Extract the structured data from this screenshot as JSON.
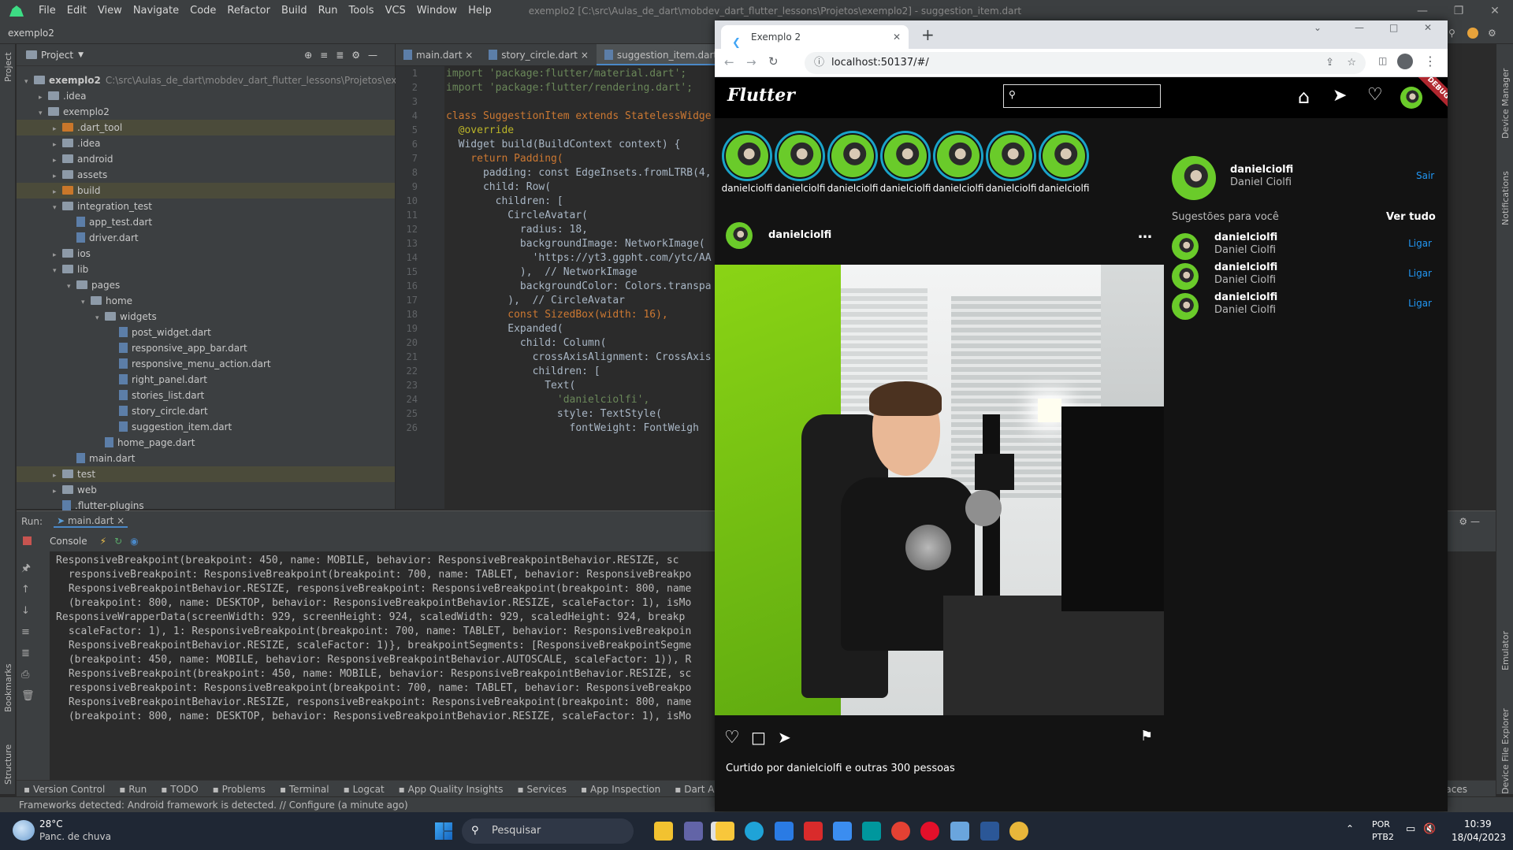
{
  "ide": {
    "menu": [
      "File",
      "Edit",
      "View",
      "Navigate",
      "Code",
      "Refactor",
      "Build",
      "Run",
      "Tools",
      "VCS",
      "Window",
      "Help"
    ],
    "title": "exemplo2 [C:\\src\\Aulas_de_dart\\mobdev_dart_flutter_lessons\\Projetos\\exemplo2] - suggestion_item.dart",
    "breadcrumb": "exemplo2",
    "project_label": "Project",
    "left_strip": [
      "Project",
      "Bookmarks",
      "Structure"
    ],
    "right_strip": [
      "Device Manager",
      "Notifications",
      "Emulator",
      "Device File Explorer"
    ],
    "tree": [
      {
        "label": "exemplo2",
        "extra": "C:\\src\\Aulas_de_dart\\mobdev_dart_flutter_lessons\\Projetos\\exemplc",
        "indent": 0,
        "arrow": "▾",
        "kind": "folder"
      },
      {
        "label": ".idea",
        "indent": 1,
        "arrow": "▸",
        "kind": "folder"
      },
      {
        "label": "exemplo2",
        "indent": 1,
        "arrow": "▾",
        "kind": "folder"
      },
      {
        "label": ".dart_tool",
        "indent": 2,
        "arrow": "▸",
        "kind": "folder-orange",
        "sel": true
      },
      {
        "label": ".idea",
        "indent": 2,
        "arrow": "▸",
        "kind": "folder"
      },
      {
        "label": "android",
        "indent": 2,
        "arrow": "▸",
        "kind": "folder"
      },
      {
        "label": "assets",
        "indent": 2,
        "arrow": "▸",
        "kind": "folder"
      },
      {
        "label": "build",
        "indent": 2,
        "arrow": "▸",
        "kind": "folder-orange",
        "sel": true
      },
      {
        "label": "integration_test",
        "indent": 2,
        "arrow": "▾",
        "kind": "folder"
      },
      {
        "label": "app_test.dart",
        "indent": 3,
        "arrow": "",
        "kind": "dart"
      },
      {
        "label": "driver.dart",
        "indent": 3,
        "arrow": "",
        "kind": "dart"
      },
      {
        "label": "ios",
        "indent": 2,
        "arrow": "▸",
        "kind": "folder"
      },
      {
        "label": "lib",
        "indent": 2,
        "arrow": "▾",
        "kind": "folder"
      },
      {
        "label": "pages",
        "indent": 3,
        "arrow": "▾",
        "kind": "folder"
      },
      {
        "label": "home",
        "indent": 4,
        "arrow": "▾",
        "kind": "folder"
      },
      {
        "label": "widgets",
        "indent": 5,
        "arrow": "▾",
        "kind": "folder"
      },
      {
        "label": "post_widget.dart",
        "indent": 6,
        "arrow": "",
        "kind": "dart"
      },
      {
        "label": "responsive_app_bar.dart",
        "indent": 6,
        "arrow": "",
        "kind": "dart"
      },
      {
        "label": "responsive_menu_action.dart",
        "indent": 6,
        "arrow": "",
        "kind": "dart"
      },
      {
        "label": "right_panel.dart",
        "indent": 6,
        "arrow": "",
        "kind": "dart"
      },
      {
        "label": "stories_list.dart",
        "indent": 6,
        "arrow": "",
        "kind": "dart"
      },
      {
        "label": "story_circle.dart",
        "indent": 6,
        "arrow": "",
        "kind": "dart"
      },
      {
        "label": "suggestion_item.dart",
        "indent": 6,
        "arrow": "",
        "kind": "dart"
      },
      {
        "label": "home_page.dart",
        "indent": 5,
        "arrow": "",
        "kind": "dart"
      },
      {
        "label": "main.dart",
        "indent": 3,
        "arrow": "",
        "kind": "dart"
      },
      {
        "label": "test",
        "indent": 2,
        "arrow": "▸",
        "kind": "folder",
        "sel": true
      },
      {
        "label": "web",
        "indent": 2,
        "arrow": "▸",
        "kind": "folder"
      },
      {
        "label": ".flutter-plugins",
        "indent": 2,
        "arrow": "",
        "kind": "dart"
      }
    ],
    "editor_tabs": [
      "main.dart",
      "story_circle.dart",
      "suggestion_item.dart"
    ],
    "line_numbers": [
      "1",
      "2",
      "3",
      "4",
      "5",
      "6",
      "7",
      "8",
      "9",
      "10",
      "11",
      "12",
      "13",
      "14",
      "15",
      "16",
      "17",
      "18",
      "19",
      "20",
      "21",
      "22",
      "23",
      "24",
      "25",
      "26"
    ],
    "code_lines": [
      "import 'package:flutter/material.dart';",
      "import 'package:flutter/rendering.dart';",
      "",
      "class SuggestionItem extends StatelessWidge",
      "  @override",
      "  Widget build(BuildContext context) {",
      "    return Padding(",
      "      padding: const EdgeInsets.fromLTRB(4,",
      "      child: Row(",
      "        children: [",
      "          CircleAvatar(",
      "            radius: 18,",
      "            backgroundImage: NetworkImage(",
      "              'https://yt3.ggpht.com/ytc/AA",
      "            ),  // NetworkImage",
      "            backgroundColor: Colors.transpa",
      "          ),  // CircleAvatar",
      "          const SizedBox(width: 16),",
      "          Expanded(",
      "            child: Column(",
      "              crossAxisAlignment: CrossAxis",
      "              children: [",
      "                Text(",
      "                  'danielciolfi',",
      "                  style: TextStyle(",
      "                    fontWeight: FontWeigh"
    ],
    "run_label": "Run:",
    "run_tab": "main.dart",
    "console_label": "Console",
    "console_lines": [
      "ResponsiveBreakpoint(breakpoint: 450, name: MOBILE, behavior: ResponsiveBreakpointBehavior.RESIZE, sc",
      " responsiveBreakpoint: ResponsiveBreakpoint(breakpoint: 700, name: TABLET, behavior: ResponsiveBreakpo",
      " ResponsiveBreakpointBehavior.RESIZE, responsiveBreakpoint: ResponsiveBreakpoint(breakpoint: 800, name",
      " (breakpoint: 800, name: DESKTOP, behavior: ResponsiveBreakpointBehavior.RESIZE, scaleFactor: 1), isMo",
      "ResponsiveWrapperData(screenWidth: 929, screenHeight: 924, scaledWidth: 929, scaledHeight: 924, breakp",
      " scaleFactor: 1), 1: ResponsiveBreakpoint(breakpoint: 700, name: TABLET, behavior: ResponsiveBreakpoin",
      " ResponsiveBreakpointBehavior.RESIZE, scaleFactor: 1)}, breakpointSegments: [ResponsiveBreakpointSegme",
      " (breakpoint: 450, name: MOBILE, behavior: ResponsiveBreakpointBehavior.AUTOSCALE, scaleFactor: 1)), R",
      " ResponsiveBreakpoint(breakpoint: 450, name: MOBILE, behavior: ResponsiveBreakpointBehavior.RESIZE, sc",
      " responsiveBreakpoint: ResponsiveBreakpoint(breakpoint: 700, name: TABLET, behavior: ResponsiveBreakpo",
      " ResponsiveBreakpointBehavior.RESIZE, responsiveBreakpoint: ResponsiveBreakpoint(breakpoint: 800, name",
      " (breakpoint: 800, name: DESKTOP, behavior: ResponsiveBreakpointBehavior.RESIZE, scaleFactor: 1), isMo"
    ],
    "bottom_tools": [
      "Version Control",
      "Run",
      "TODO",
      "Problems",
      "Terminal",
      "Logcat",
      "App Quality Insights",
      "Services",
      "App Inspection",
      "Dart A"
    ],
    "bottom_right": "aces",
    "status": "Frameworks detected: Android framework is detected. // Configure (a minute ago)"
  },
  "browser": {
    "tab_title": "Exemplo 2",
    "url": "localhost:50137/#/"
  },
  "app": {
    "logo": "Flutter",
    "debug_badge": "DEBUG",
    "stories": [
      "danielciolfi",
      "danielciolfi",
      "danielciolfi",
      "danielciolfi",
      "danielciolfi",
      "danielciolfi",
      "danielciolfi"
    ],
    "post": {
      "author": "danielciolfi",
      "liked_by": "Curtido por danielciolfi e outras 300 pessoas"
    },
    "profile": {
      "username": "danielciolfi",
      "name": "Daniel Ciolfi",
      "action": "Sair"
    },
    "suggestions_title": "Sugestões para você",
    "see_all": "Ver tudo",
    "suggestions": [
      {
        "username": "danielciolfi",
        "name": "Daniel Ciolfi",
        "action": "Ligar"
      },
      {
        "username": "danielciolfi",
        "name": "Daniel Ciolfi",
        "action": "Ligar"
      },
      {
        "username": "danielciolfi",
        "name": "Daniel Ciolfi",
        "action": "Ligar"
      }
    ]
  },
  "taskbar": {
    "weather_temp": "28°C",
    "weather_desc": "Panc. de chuva",
    "search_placeholder": "Pesquisar",
    "lang1": "POR",
    "lang2": "PTB2",
    "time": "10:39",
    "date": "18/04/2023"
  }
}
